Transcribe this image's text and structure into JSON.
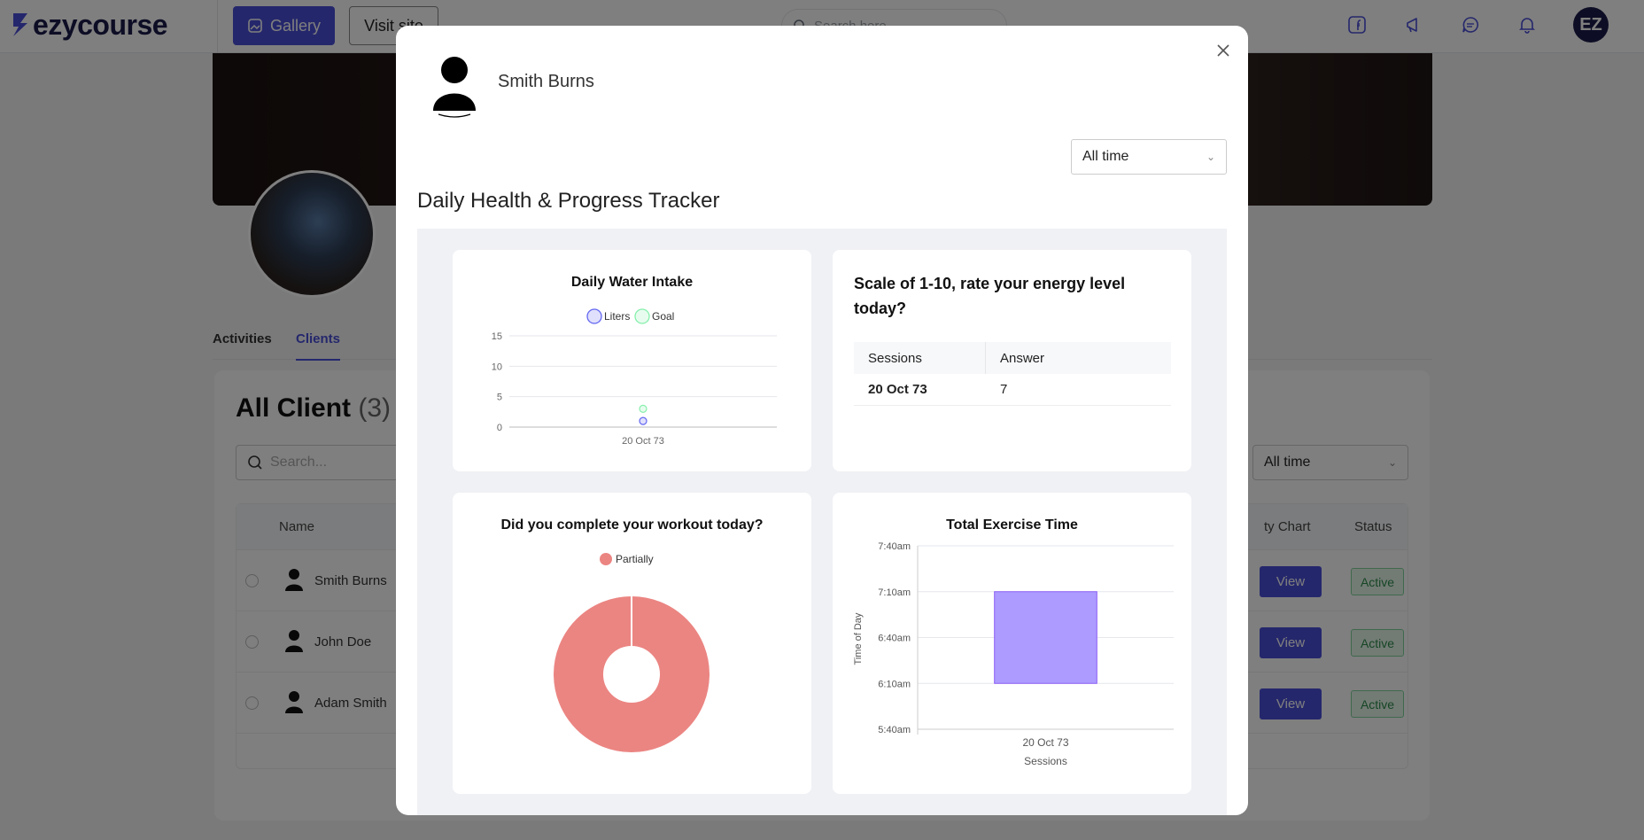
{
  "topbar": {
    "logo_text": "ezycourse",
    "gallery_label": "Gallery",
    "visit_site_label": "Visit site",
    "search_placeholder": "Search here",
    "avatar_text": "EZ"
  },
  "profile": {
    "tabs": [
      "Activities",
      "Clients"
    ],
    "active_tab": "Clients"
  },
  "clients": {
    "title": "All Client",
    "count": "(3)",
    "search_placeholder": "Search...",
    "filter_value": "All time",
    "columns": [
      "Name",
      "ty Chart",
      "Status"
    ],
    "rows": [
      {
        "name": "Smith Burns",
        "action": "View",
        "status": "Active"
      },
      {
        "name": "John Doe",
        "action": "View",
        "status": "Active"
      },
      {
        "name": "Adam Smith",
        "action": "View",
        "status": "Active"
      }
    ]
  },
  "modal": {
    "username": "Smith Burns",
    "filter_value": "All time",
    "tracker_title": "Daily Health & Progress Tracker",
    "energy": {
      "question": "Scale of 1-10, rate your energy level today?",
      "col_sessions": "Sessions",
      "col_answer": "Answer",
      "rows": [
        {
          "session": "20 Oct 73",
          "answer": "7"
        }
      ]
    }
  },
  "colors": {
    "accent": "#4a4fd8",
    "liters": "#6366f1",
    "goal": "#86efac",
    "pie": "#eb8582",
    "bar": "#ad9bff",
    "bar_border": "#8b5cf6"
  },
  "chart_data": [
    {
      "type": "scatter",
      "title": "Daily Water Intake",
      "legend": [
        "Liters",
        "Goal"
      ],
      "categories": [
        "20 Oct 73"
      ],
      "series": [
        {
          "name": "Liters",
          "values": [
            1
          ]
        },
        {
          "name": "Goal",
          "values": [
            3
          ]
        }
      ],
      "yticks": [
        "15",
        "10",
        "5",
        "0"
      ],
      "ylim": [
        0,
        15
      ],
      "grid": true,
      "legend_position": "top"
    },
    {
      "type": "pie",
      "title": "Did you complete your workout today?",
      "legend": [
        "Partially"
      ],
      "slices": [
        {
          "label": "Partially",
          "value": 1
        }
      ],
      "donut": true,
      "legend_position": "top"
    },
    {
      "type": "bar",
      "title": "Total Exercise Time",
      "categories": [
        "20 Oct 73"
      ],
      "ylabel": "Time of Day",
      "xlabel": "Sessions",
      "yticks": [
        "7:40am",
        "7:10am",
        "6:40am",
        "6:10am",
        "5:40am"
      ],
      "ylim": [
        "5:40am",
        "7:40am"
      ],
      "bars": [
        {
          "category": "20 Oct 73",
          "start": "6:10am",
          "end": "7:10am"
        }
      ],
      "grid": true
    }
  ]
}
